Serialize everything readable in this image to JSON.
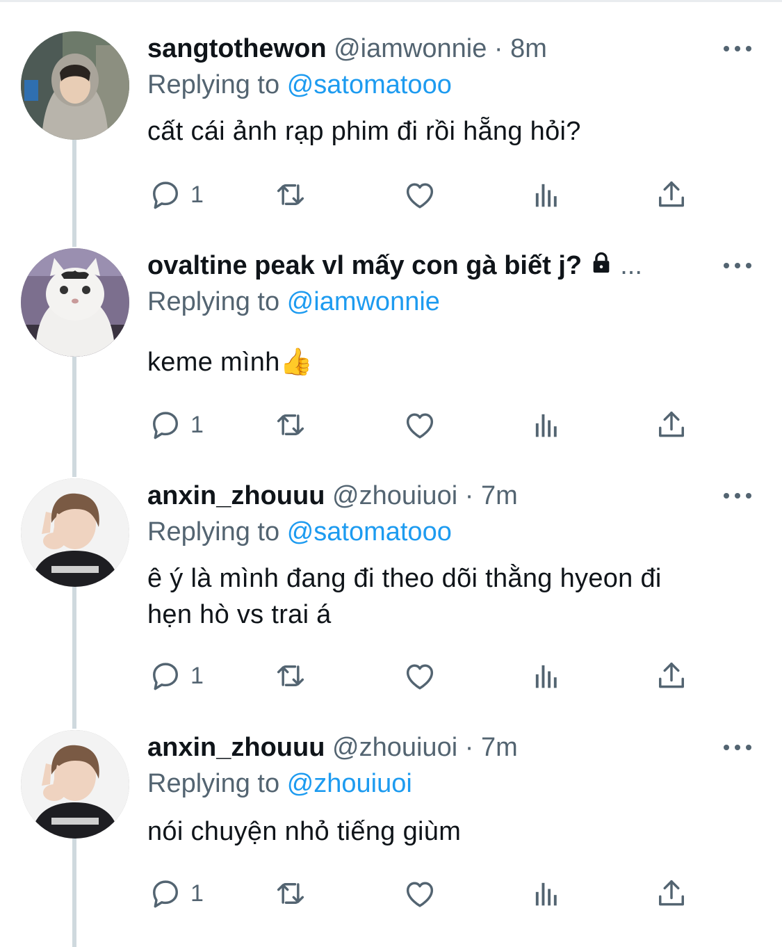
{
  "colors": {
    "text": "#0f1419",
    "secondary": "#536471",
    "accent": "#1d9bf0",
    "thread_line": "#cfd9de"
  },
  "tweets": [
    {
      "name": "sangtothewon",
      "handle": "@iamwonnie",
      "separator": "·",
      "time": "8m",
      "replying_label": "Replying to",
      "replying_to": "@satomatooo",
      "text": "cất cái ảnh rạp phim đi rồi hẵng hỏi?",
      "reply_count": "1",
      "avatar_icon": "avatar-hooded-person"
    },
    {
      "name": "ovaltine peak vl mấy con gà biết j?",
      "truncation": "...",
      "protected_icon": "lock-icon",
      "replying_label": "Replying to",
      "replying_to": "@iamwonnie",
      "text": "keme mình👍",
      "reply_count": "1",
      "avatar_icon": "avatar-white-cat"
    },
    {
      "name": "anxin_zhouuu",
      "handle": "@zhouiuoi",
      "separator": "·",
      "time": "7m",
      "replying_label": "Replying to",
      "replying_to": "@satomatooo",
      "text_line1": "ê ý là mình đang đi theo dõi thằng hyeon đi",
      "text_line2": "hẹn hò vs trai á",
      "reply_count": "1",
      "avatar_icon": "avatar-person-peace-sign"
    },
    {
      "name": "anxin_zhouuu",
      "handle": "@zhouiuoi",
      "separator": "·",
      "time": "7m",
      "replying_label": "Replying to",
      "replying_to": "@zhouiuoi",
      "text": "nói chuyện nhỏ tiếng giùm",
      "reply_count": "1",
      "avatar_icon": "avatar-person-peace-sign"
    }
  ],
  "action_icons": [
    "reply-icon",
    "retweet-icon",
    "like-icon",
    "analytics-icon",
    "share-icon"
  ]
}
